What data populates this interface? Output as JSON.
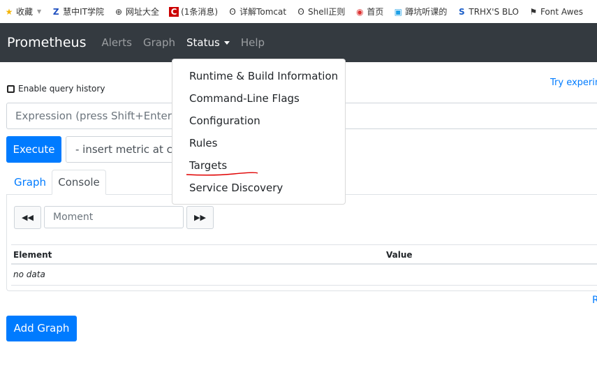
{
  "bookmarks": [
    {
      "label": "收藏",
      "icon": "star-icon"
    },
    {
      "label": "慧中IT学院",
      "icon": "logo-icon"
    },
    {
      "label": "网址大全",
      "icon": "globe-icon"
    },
    {
      "label": "(1条消息)",
      "icon": "csdn-icon"
    },
    {
      "label": "详解Tomcat",
      "icon": "bookmark-icon"
    },
    {
      "label": "Shell正则",
      "icon": "bookmark-icon"
    },
    {
      "label": "首页",
      "icon": "home-icon"
    },
    {
      "label": "蹲坑听课的",
      "icon": "bilibili-icon"
    },
    {
      "label": "TRHX'S BLO",
      "icon": "s-logo-icon"
    },
    {
      "label": "Font Awes",
      "icon": "flag-icon"
    }
  ],
  "navbar": {
    "brand": "Prometheus",
    "links": [
      "Alerts",
      "Graph",
      "Status",
      "Help"
    ]
  },
  "status_menu": [
    "Runtime & Build Information",
    "Command-Line Flags",
    "Configuration",
    "Rules",
    "Targets",
    "Service Discovery"
  ],
  "query_history_label": "Enable query history",
  "try_link": "Try experim",
  "expression_placeholder": "Expression (press Shift+Enter for newlines)",
  "execute_label": "Execute",
  "metric_select": "- insert metric at cursor -",
  "tabs": {
    "graph": "Graph",
    "console": "Console"
  },
  "moment_placeholder": "Moment",
  "table": {
    "headers": [
      "Element",
      "Value"
    ],
    "empty": "no data"
  },
  "remove_link": "R",
  "add_graph": "Add Graph",
  "colors": {
    "navbar": "#343a40",
    "primary": "#007bff",
    "annotation": "#e00000"
  }
}
